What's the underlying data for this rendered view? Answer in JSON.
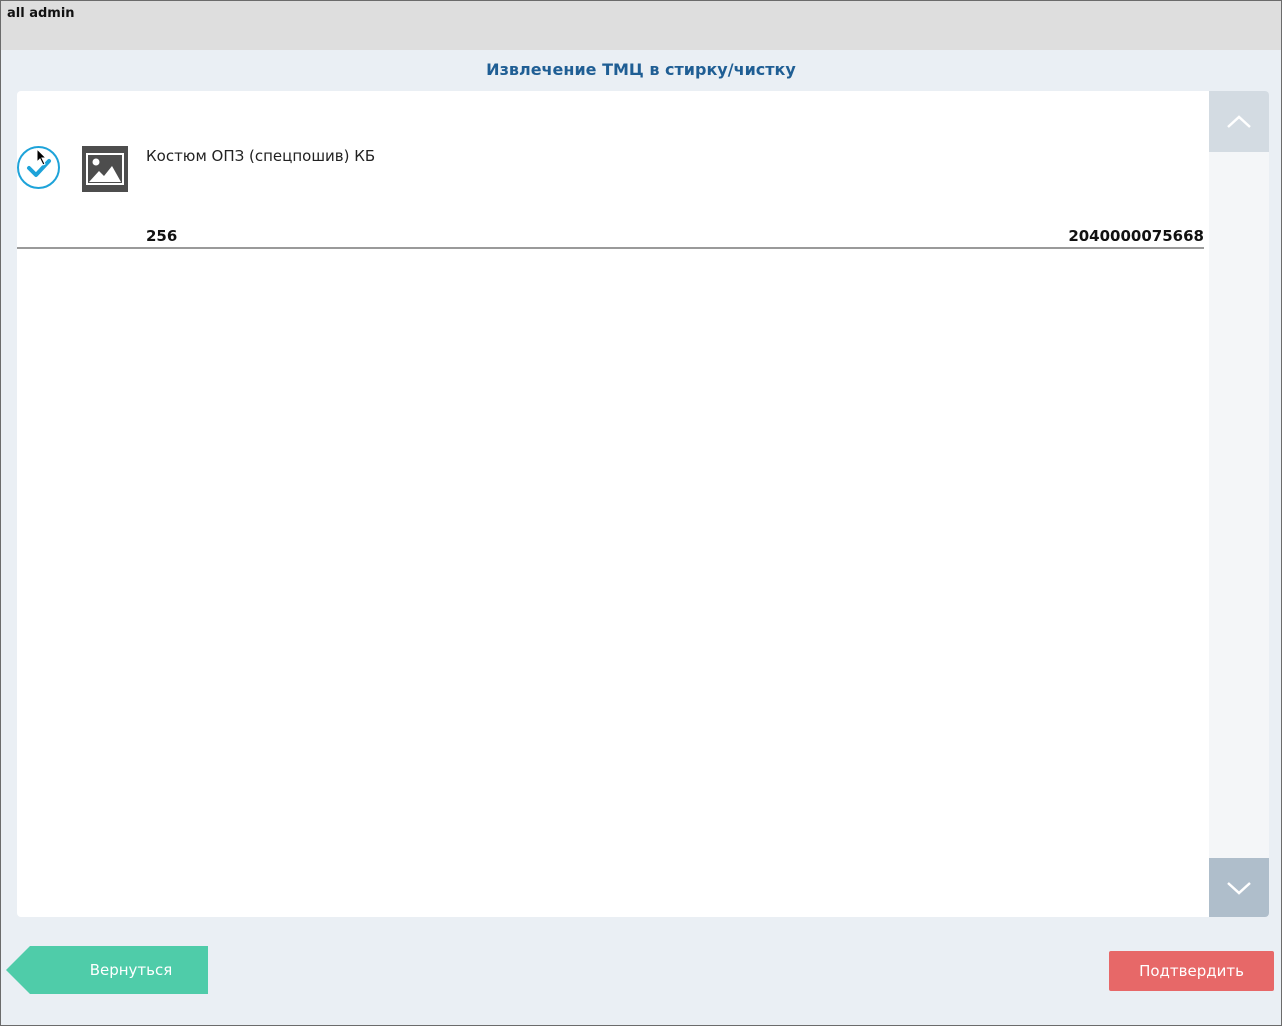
{
  "header": {
    "user": "all admin"
  },
  "page": {
    "title": "Извлечение ТМЦ в стирку/чистку"
  },
  "items": [
    {
      "name": "Костюм ОПЗ (спецпошив) КБ",
      "quantity": "256",
      "barcode": "2040000075668",
      "checked": true
    }
  ],
  "buttons": {
    "back": "Вернуться",
    "confirm": "Подтвердить"
  },
  "colors": {
    "accent_blue": "#1ea3d9",
    "back_green": "#4fcca9",
    "confirm_red": "#e76868",
    "title_blue": "#1f5e94"
  }
}
